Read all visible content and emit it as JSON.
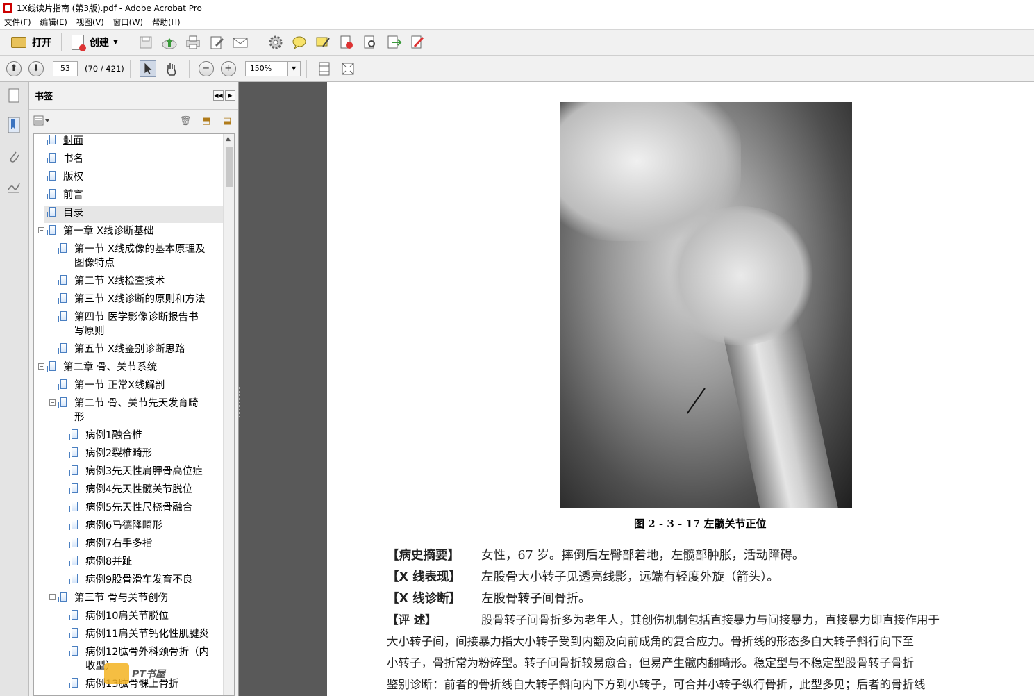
{
  "window": {
    "title": "1X线读片指南 (第3版).pdf - Adobe Acrobat Pro"
  },
  "menu": [
    "文件(F)",
    "编辑(E)",
    "视图(V)",
    "窗口(W)",
    "帮助(H)"
  ],
  "toolbar": {
    "open_label": "打开",
    "create_label": "创建"
  },
  "nav": {
    "page_number": "53",
    "page_info": "(70 / 421)",
    "zoom": "150%"
  },
  "panel": {
    "title": "书签"
  },
  "bookmarks": [
    {
      "label": "封面"
    },
    {
      "label": "书名"
    },
    {
      "label": "版权"
    },
    {
      "label": "前言"
    },
    {
      "label": "目录"
    },
    {
      "label": "第一章  X线诊断基础"
    },
    {
      "label": "第一节  X线成像的基本原理及",
      "label2": "图像特点"
    },
    {
      "label": "第二节  X线检查技术"
    },
    {
      "label": "第三节  X线诊断的原则和方法"
    },
    {
      "label": "第四节  医学影像诊断报告书",
      "label2": "写原则"
    },
    {
      "label": "第五节  X线鉴别诊断思路"
    },
    {
      "label": "第二章  骨、关节系统"
    },
    {
      "label": "第一节  正常X线解剖"
    },
    {
      "label": "第二节  骨、关节先天发育畸",
      "label2": "形"
    },
    {
      "label": "病例1融合椎"
    },
    {
      "label": "病例2裂椎畸形"
    },
    {
      "label": "病例3先天性肩胛骨高位症"
    },
    {
      "label": "病例4先天性髋关节脱位"
    },
    {
      "label": "病例5先天性尺桡骨融合"
    },
    {
      "label": "病例6马德隆畸形"
    },
    {
      "label": "病例7右手多指"
    },
    {
      "label": "病例8并趾"
    },
    {
      "label": "病例9股骨滑车发育不良"
    },
    {
      "label": "第三节  骨与关节创伤"
    },
    {
      "label": "病例10肩关节脱位"
    },
    {
      "label": "病例11肩关节钙化性肌腱炎"
    },
    {
      "label": "病例12肱骨外科颈骨折（内",
      "label2": "收型）"
    },
    {
      "label": "病例13肱骨髁上骨折"
    }
  ],
  "document": {
    "caption": "图 2 - 3 - 17    左髋关节正位",
    "history_label": "【病史摘要】",
    "history_text": "女性，67 岁。摔倒后左臀部着地，左髋部肿胀，活动障碍。",
    "findings_label": "【X 线表现】",
    "findings_text": "左股骨大小转子见透亮线影，远端有轻度外旋（箭头）。",
    "diagnosis_label": "【X 线诊断】",
    "diagnosis_text": "左股骨转子间骨折。",
    "review_label": "【评      述】",
    "review_text": "股骨转子间骨折多为老年人，其创伤机制包括直接暴力与间接暴力，直接暴力即直接作用于",
    "line2": "大小转子间，间接暴力指大小转子受到内翻及向前成角的复合应力。骨折线的形态多自大转子斜行向下至",
    "line3": "小转子，骨折常为粉碎型。转子间骨折较易愈合，但易产生髋内翻畸形。稳定型与不稳定型股骨转子骨折",
    "line4": "鉴别诊断：前者的骨折线自大转子斜向内下方到小转子，可合并小转子纵行骨折，此型多见；后者的骨折线"
  },
  "watermark": {
    "text": "PT书屋"
  }
}
